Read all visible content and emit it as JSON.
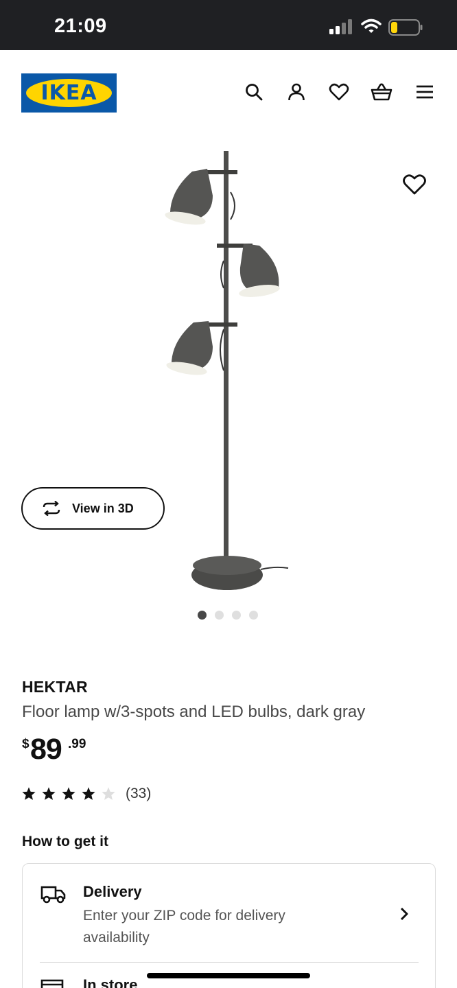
{
  "status_bar": {
    "time": "21:09"
  },
  "header": {
    "logo_text": "IKEA",
    "icons": [
      "search-icon",
      "account-icon",
      "heart-icon",
      "cart-icon",
      "menu-icon"
    ]
  },
  "gallery": {
    "view3d_label": "View in 3D",
    "total_images": 4,
    "active_index": 0
  },
  "product": {
    "name": "HEKTAR",
    "description": "Floor lamp w/3-spots and LED bulbs, dark gray",
    "price_symbol": "$",
    "price_int": "89",
    "price_dec": ".99",
    "rating_stars": 4,
    "rating_count": "(33)"
  },
  "fulfillment": {
    "title": "How to get it",
    "delivery_title": "Delivery",
    "delivery_sub": "Enter your ZIP code for delivery availability",
    "store_title": "In store"
  },
  "colors": {
    "ikea_blue": "#0a58a8",
    "ikea_yellow": "#ffd400",
    "status_bar": "#1f2023",
    "lamp_gray": "#4d4d4b"
  }
}
